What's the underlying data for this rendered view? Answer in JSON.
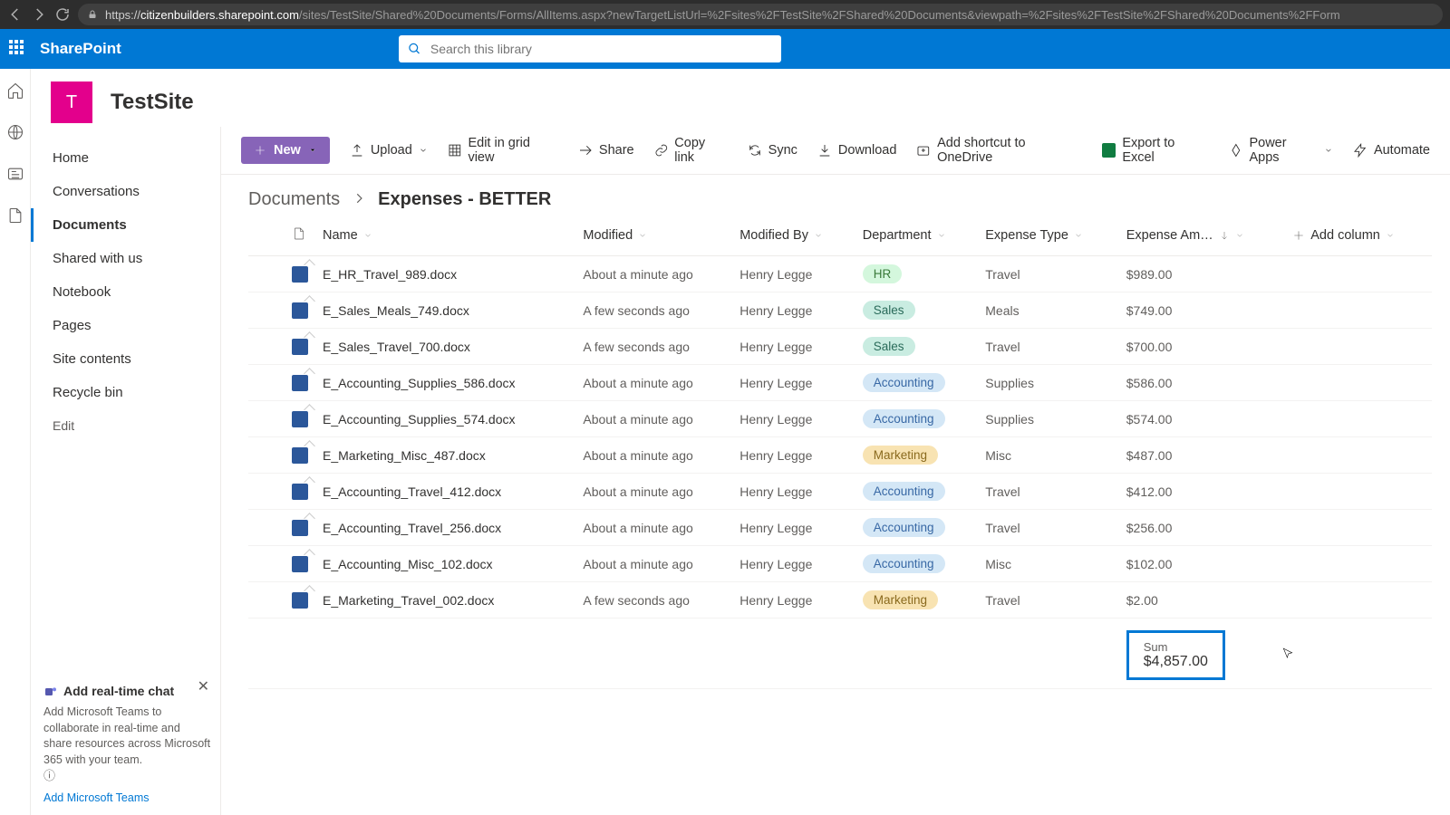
{
  "browser": {
    "host": "citizenbuilders.sharepoint.com",
    "path": "/sites/TestSite/Shared%20Documents/Forms/AllItems.aspx?newTargetListUrl=%2Fsites%2FTestSite%2FShared%20Documents&viewpath=%2Fsites%2FTestSite%2FShared%20Documents%2FForm"
  },
  "suite": {
    "title": "SharePoint"
  },
  "search": {
    "placeholder": "Search this library"
  },
  "site": {
    "initial": "T",
    "name": "TestSite"
  },
  "nav": {
    "items": [
      "Home",
      "Conversations",
      "Documents",
      "Shared with us",
      "Notebook",
      "Pages",
      "Site contents",
      "Recycle bin"
    ],
    "edit": "Edit",
    "active_index": 2
  },
  "promo": {
    "title": "Add real-time chat",
    "body": "Add Microsoft Teams to collaborate in real-time and share resources across Microsoft 365 with your team.",
    "link": "Add Microsoft Teams"
  },
  "cmd": {
    "new": "New",
    "upload": "Upload",
    "edit_grid": "Edit in grid view",
    "share": "Share",
    "copy_link": "Copy link",
    "sync": "Sync",
    "download": "Download",
    "shortcut": "Add shortcut to OneDrive",
    "export": "Export to Excel",
    "power_apps": "Power Apps",
    "automate": "Automate"
  },
  "breadcrumb": {
    "parent": "Documents",
    "current": "Expenses - BETTER"
  },
  "columns": {
    "name": "Name",
    "modified": "Modified",
    "modified_by": "Modified By",
    "department": "Department",
    "expense_type": "Expense Type",
    "amount": "Expense Am…",
    "add": "Add column"
  },
  "rows": [
    {
      "name": "E_HR_Travel_989.docx",
      "modified": "About a minute ago",
      "by": "Henry Legge",
      "dept": "HR",
      "dept_class": "pill-hr",
      "type": "Travel",
      "amount": "$989.00"
    },
    {
      "name": "E_Sales_Meals_749.docx",
      "modified": "A few seconds ago",
      "by": "Henry Legge",
      "dept": "Sales",
      "dept_class": "pill-sales",
      "type": "Meals",
      "amount": "$749.00"
    },
    {
      "name": "E_Sales_Travel_700.docx",
      "modified": "A few seconds ago",
      "by": "Henry Legge",
      "dept": "Sales",
      "dept_class": "pill-sales",
      "type": "Travel",
      "amount": "$700.00"
    },
    {
      "name": "E_Accounting_Supplies_586.docx",
      "modified": "About a minute ago",
      "by": "Henry Legge",
      "dept": "Accounting",
      "dept_class": "pill-accounting",
      "type": "Supplies",
      "amount": "$586.00"
    },
    {
      "name": "E_Accounting_Supplies_574.docx",
      "modified": "About a minute ago",
      "by": "Henry Legge",
      "dept": "Accounting",
      "dept_class": "pill-accounting",
      "type": "Supplies",
      "amount": "$574.00"
    },
    {
      "name": "E_Marketing_Misc_487.docx",
      "modified": "About a minute ago",
      "by": "Henry Legge",
      "dept": "Marketing",
      "dept_class": "pill-marketing",
      "type": "Misc",
      "amount": "$487.00"
    },
    {
      "name": "E_Accounting_Travel_412.docx",
      "modified": "About a minute ago",
      "by": "Henry Legge",
      "dept": "Accounting",
      "dept_class": "pill-accounting",
      "type": "Travel",
      "amount": "$412.00"
    },
    {
      "name": "E_Accounting_Travel_256.docx",
      "modified": "About a minute ago",
      "by": "Henry Legge",
      "dept": "Accounting",
      "dept_class": "pill-accounting",
      "type": "Travel",
      "amount": "$256.00"
    },
    {
      "name": "E_Accounting_Misc_102.docx",
      "modified": "About a minute ago",
      "by": "Henry Legge",
      "dept": "Accounting",
      "dept_class": "pill-accounting",
      "type": "Misc",
      "amount": "$102.00"
    },
    {
      "name": "E_Marketing_Travel_002.docx",
      "modified": "A few seconds ago",
      "by": "Henry Legge",
      "dept": "Marketing",
      "dept_class": "pill-marketing",
      "type": "Travel",
      "amount": "$2.00"
    }
  ],
  "sum": {
    "label": "Sum",
    "value": "$4,857.00"
  }
}
